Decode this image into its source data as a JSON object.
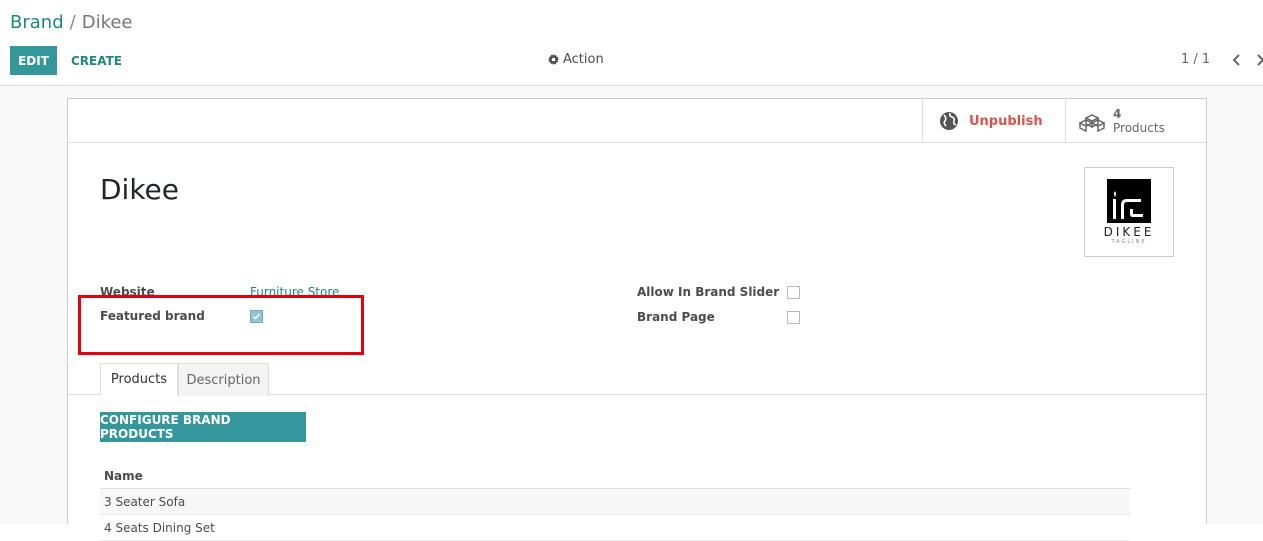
{
  "breadcrumb": {
    "parent": "Brand",
    "separator": "/",
    "current": "Dikee"
  },
  "toolbar": {
    "edit_label": "EDIT",
    "create_label": "CREATE",
    "action_label": "Action"
  },
  "pager": {
    "text": "1 / 1"
  },
  "stat_buttons": {
    "unpublish_label": "Unpublish",
    "products_count": "4",
    "products_label": "Products"
  },
  "record": {
    "title": "Dikee",
    "logo": {
      "name": "DIKEE",
      "tagline": "TAGLINE"
    }
  },
  "fields": {
    "website_label": "Website",
    "website_value": "Furniture Store",
    "featured_label": "Featured brand",
    "featured_checked": true,
    "slider_label": "Allow In Brand Slider",
    "slider_checked": false,
    "brand_page_label": "Brand Page",
    "brand_page_checked": false
  },
  "tabs": [
    {
      "label": "Products",
      "active": true
    },
    {
      "label": "Description",
      "active": false
    }
  ],
  "products": {
    "configure_label": "CONFIGURE BRAND PRODUCTS",
    "column_header": "Name",
    "rows": [
      {
        "name": "3 Seater Sofa"
      },
      {
        "name": "4 Seats Dining Set"
      }
    ]
  },
  "colors": {
    "primary": "#35979c",
    "link": "#21867b",
    "danger": "#d9534f",
    "highlight": "#e3000f"
  }
}
